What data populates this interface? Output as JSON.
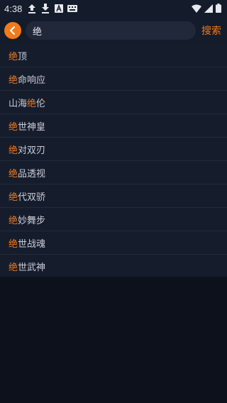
{
  "status_bar": {
    "time": "4:38",
    "icons": [
      "upload-icon",
      "download-icon",
      "app-notification-icon",
      "keyboard-icon"
    ],
    "right_icons": [
      "wifi-icon",
      "signal-icon",
      "battery-icon"
    ]
  },
  "search": {
    "query": "绝",
    "button_label": "搜索"
  },
  "colors": {
    "accent": "#f07a1c",
    "list_background": "#151c2c",
    "page_background": "#0c111b",
    "text": "#c9ced8"
  },
  "results": [
    {
      "pre": "",
      "match": "绝",
      "post": "顶"
    },
    {
      "pre": "",
      "match": "绝",
      "post": "命响应"
    },
    {
      "pre": "山海",
      "match": "绝",
      "post": "伦"
    },
    {
      "pre": "",
      "match": "绝",
      "post": "世神皇"
    },
    {
      "pre": "",
      "match": "绝",
      "post": "对双刃"
    },
    {
      "pre": "",
      "match": "绝",
      "post": "品透视"
    },
    {
      "pre": "",
      "match": "绝",
      "post": "代双骄"
    },
    {
      "pre": "",
      "match": "绝",
      "post": "妙舞步"
    },
    {
      "pre": "",
      "match": "绝",
      "post": "世战魂"
    },
    {
      "pre": "",
      "match": "绝",
      "post": "世武神"
    }
  ]
}
